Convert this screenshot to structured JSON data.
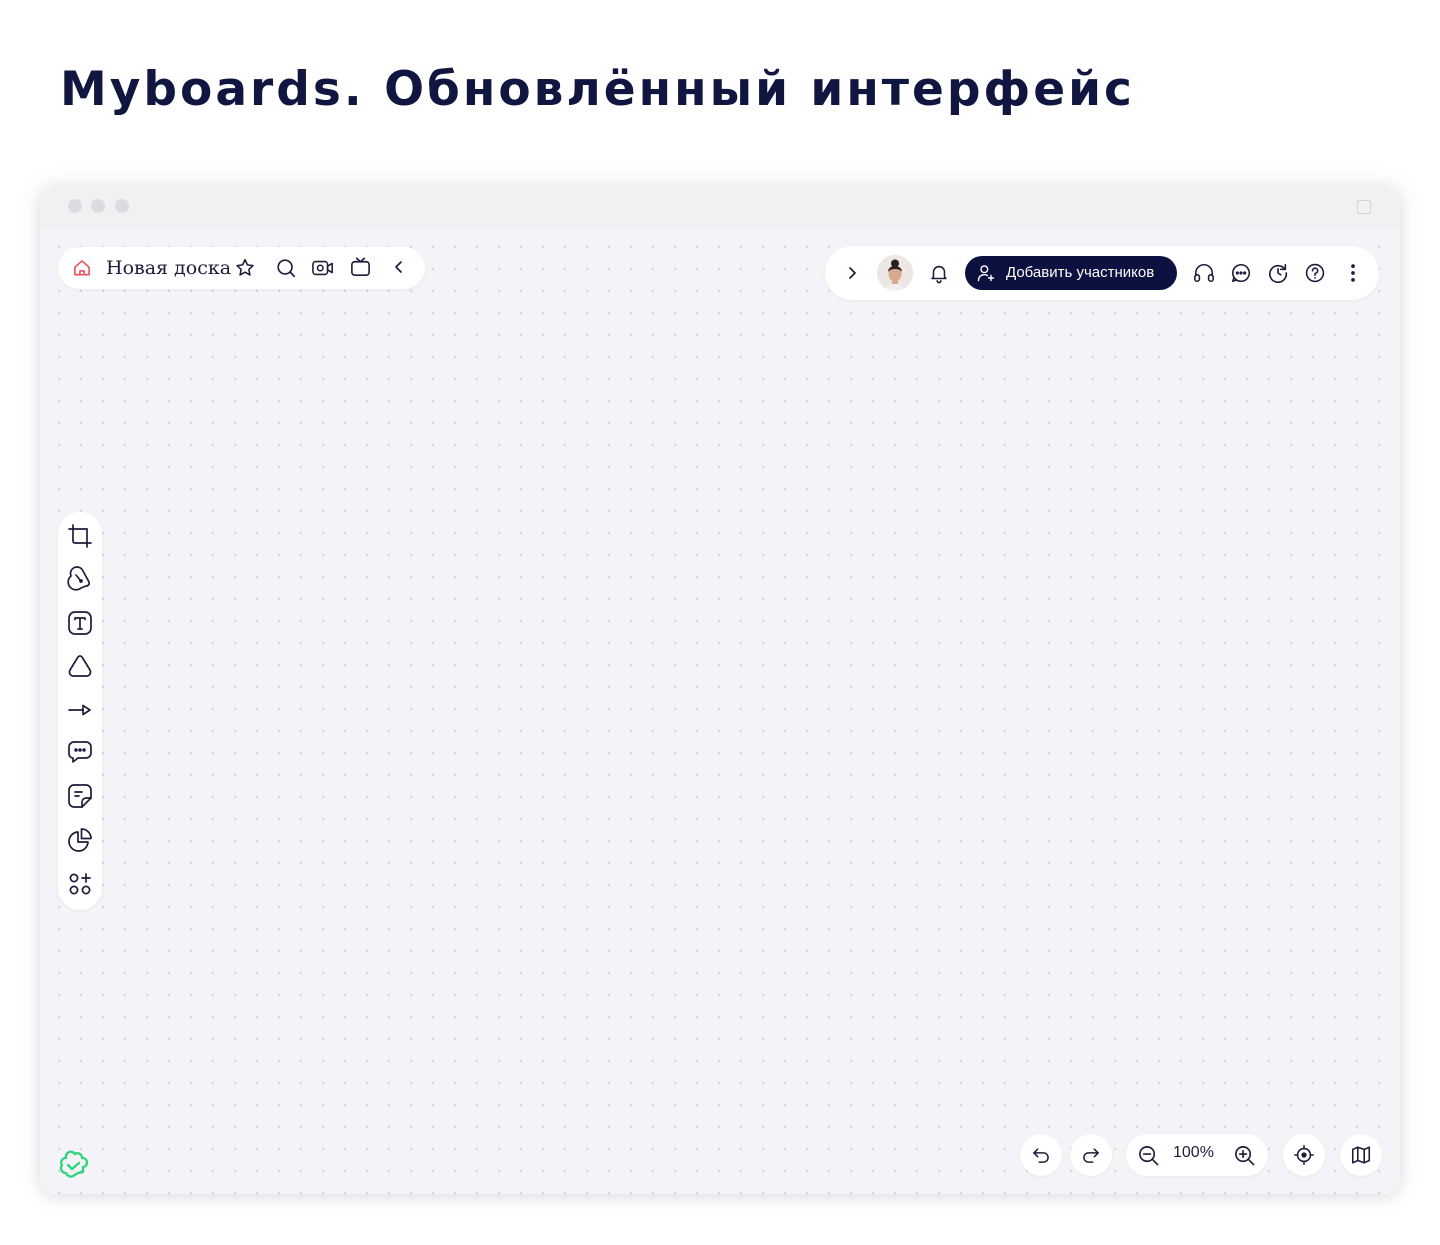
{
  "page": {
    "title": "Myboards. Обновлённый интерфейс"
  },
  "board": {
    "name": "Новая доска",
    "left_icons": [
      "home-icon",
      "star-icon",
      "search-icon",
      "video-icon",
      "presentation-icon",
      "collapse-left-icon"
    ]
  },
  "top_right": {
    "expand_icon": "chevron-right-icon",
    "add_participants_label": "Добавить участников",
    "icons": [
      "bell-icon",
      "headphones-icon",
      "chat-icon",
      "history-icon",
      "help-icon",
      "more-icon"
    ]
  },
  "toolbar": {
    "tools": [
      "frame-tool",
      "pen-tool",
      "text-tool",
      "shape-tool",
      "connector-tool",
      "comment-tool",
      "sticker-tool",
      "diagram-tool",
      "apps-tool"
    ]
  },
  "bottom": {
    "zoom_level": "100%",
    "icons": [
      "undo-icon",
      "redo-icon",
      "zoom-out-icon",
      "zoom-in-icon",
      "locate-icon",
      "minimap-icon"
    ]
  },
  "colors": {
    "accent_dark": "#0d1140",
    "home_icon": "#e8505b",
    "logo_green": "#2ed47a",
    "canvas_bg": "#f4f3f7"
  }
}
